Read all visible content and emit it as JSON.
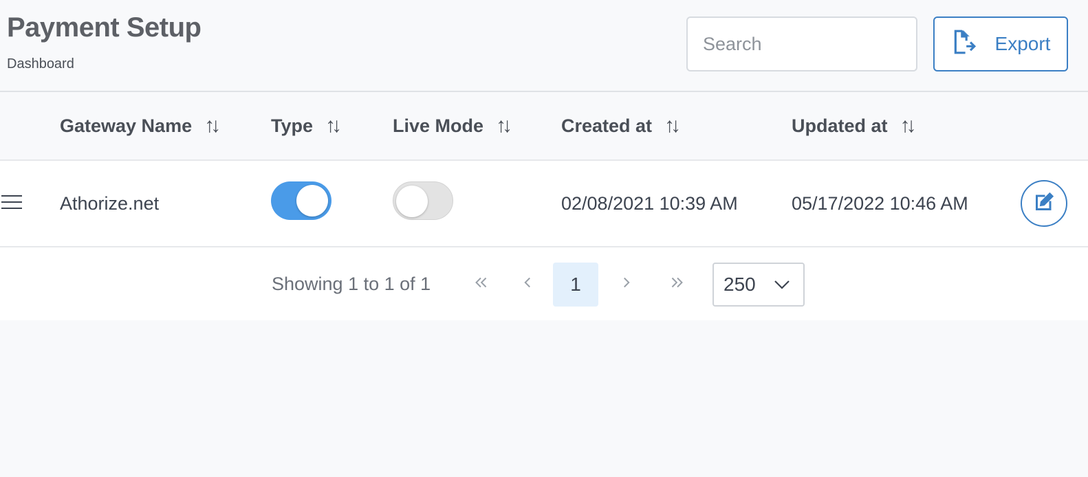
{
  "header": {
    "title": "Payment Setup",
    "breadcrumb": "Dashboard",
    "search_placeholder": "Search",
    "export_label": "Export"
  },
  "table": {
    "columns": [
      "Gateway Name",
      "Type",
      "Live Mode",
      "Created at",
      "Updated at"
    ],
    "sort_icon": "↑↓",
    "rows": [
      {
        "gateway_name": "Athorize.net",
        "type_enabled": true,
        "live_mode": false,
        "created_at": "02/08/2021 10:39 AM",
        "updated_at": "05/17/2022 10:46 AM"
      }
    ]
  },
  "pagination": {
    "showing": "Showing 1 to 1 of 1",
    "current_page": "1",
    "rows_per_page": "250"
  },
  "colors": {
    "accent": "#3b7fc4",
    "toggle_on": "#4a9be8",
    "toggle_off": "#e3e3e3",
    "current_page_bg": "#e3f0fc"
  },
  "icons": {
    "export": "file-export-icon",
    "drag": "drag-handle-icon",
    "edit": "edit-icon",
    "sort": "sort-icon",
    "first": "double-chevron-left-icon",
    "prev": "chevron-left-icon",
    "next": "chevron-right-icon",
    "last": "double-chevron-right-icon",
    "dropdown": "chevron-down-icon"
  }
}
